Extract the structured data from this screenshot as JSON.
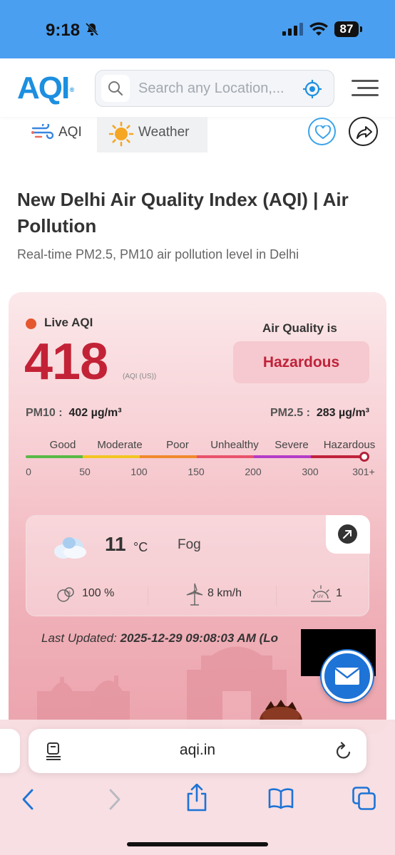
{
  "status_bar": {
    "time": "9:18",
    "battery": "87"
  },
  "header": {
    "logo": "AQI",
    "logo_mark": "®",
    "search_placeholder": "Search any Location,..."
  },
  "tabs": [
    {
      "label": "AQI"
    },
    {
      "label": "Weather"
    }
  ],
  "page": {
    "title": "New Delhi Air Quality Index (AQI) | Air Pollution",
    "subtitle": "Real-time PM2.5, PM10 air pollution level in Delhi"
  },
  "aqi_card": {
    "live_label": "Live AQI",
    "aqi_value": "418",
    "aqi_unit": "(AQI (US))",
    "air_quality_label": "Air Quality is",
    "status": "Hazardous",
    "pm10_label": "PM10 :",
    "pm10_value": "402 µg/m³",
    "pm25_label": "PM2.5 :",
    "pm25_value": "283 µg/m³",
    "scale_labels": [
      "Good",
      "Moderate",
      "Poor",
      "Unhealthy",
      "Severe",
      "Hazardous"
    ],
    "scale_numbers": [
      "0",
      "50",
      "100",
      "150",
      "200",
      "300",
      "301+"
    ],
    "scale_colors": [
      "#59b947",
      "#f2c521",
      "#f08a2c",
      "#e9526b",
      "#b43cc8",
      "#c0223a"
    ],
    "marker_level": "418"
  },
  "weather": {
    "temp": "11",
    "temp_unit": "°C",
    "condition": "Fog",
    "humidity": "100 %",
    "wind": "8 km/h",
    "uv": "1"
  },
  "last_updated": {
    "label": "Last Updated:",
    "value": "2025-12-29 09:08:03 AM (Lo"
  },
  "browser": {
    "url": "aqi.in"
  },
  "colors": {
    "status_bar": "#4a9ff0",
    "brand": "#1c8fe0",
    "hazard": "#c32236",
    "mail_button": "#1e73d6"
  }
}
